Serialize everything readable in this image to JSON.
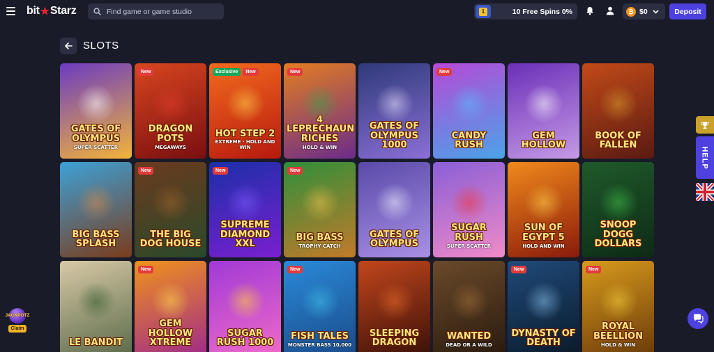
{
  "header": {
    "logo_left": "bit",
    "logo_star": "★",
    "logo_right": "Starz",
    "search_placeholder": "Find game or game studio",
    "level_badge": "1",
    "free_spins": "10 Free Spins 0%",
    "balance": "$0",
    "currency_icon": "bitcoin-icon",
    "deposit_label": "Deposit"
  },
  "page": {
    "title": "SLOTS"
  },
  "games": [
    {
      "name": "Gates of Olympus",
      "sub": "Super Scatter",
      "badges": [],
      "bg": [
        "#6c3bc1",
        "#f2b43a"
      ],
      "art": "#ffffff"
    },
    {
      "name": "Dragon Pots",
      "sub": "Megaways",
      "badges": [
        "New"
      ],
      "bg": [
        "#d7451f",
        "#7a0f10"
      ],
      "art": "#e23b2e"
    },
    {
      "name": "Hot Step 2",
      "sub": "Extreme · Hold and Win",
      "badges": [
        "Exclusive",
        "New"
      ],
      "bg": [
        "#f26a1d",
        "#b7190f"
      ],
      "art": "#ffd34d"
    },
    {
      "name": "4 Leprechaun Riches",
      "sub": "Hold & Win",
      "badges": [
        "New"
      ],
      "bg": [
        "#e37d21",
        "#6b2c8a"
      ],
      "art": "#3aa14a"
    },
    {
      "name": "Gates of Olympus 1000",
      "sub": "",
      "badges": [],
      "bg": [
        "#2f3a7a",
        "#8a6fd6"
      ],
      "art": "#e9e4ff"
    },
    {
      "name": "Candy Rush",
      "sub": "",
      "badges": [
        "New"
      ],
      "bg": [
        "#b64ad6",
        "#4aa3e8"
      ],
      "art": "#5ab8ff"
    },
    {
      "name": "Gem Hollow",
      "sub": "",
      "badges": [],
      "bg": [
        "#6b2fb8",
        "#c59ae6"
      ],
      "art": "#ffffff"
    },
    {
      "name": "Book of Fallen",
      "sub": "",
      "badges": [],
      "bg": [
        "#c24a18",
        "#5a1a12"
      ],
      "art": "#d99a2c"
    },
    {
      "name": "Big Bass Splash",
      "sub": "",
      "badges": [],
      "bg": [
        "#3da1d8",
        "#7a3c1b"
      ],
      "art": "#d88a4a"
    },
    {
      "name": "The Big Dog House",
      "sub": "",
      "badges": [
        "New"
      ],
      "bg": [
        "#6b3a1e",
        "#2a4a2a"
      ],
      "art": "#a0612c"
    },
    {
      "name": "Supreme Diamond XXL",
      "sub": "",
      "badges": [
        "New"
      ],
      "bg": [
        "#1b2fa8",
        "#7a1fd0"
      ],
      "art": "#7c5cff"
    },
    {
      "name": "Big Bass",
      "sub": "Trophy Catch",
      "badges": [
        "New"
      ],
      "bg": [
        "#2f8f3a",
        "#c27a2a"
      ],
      "art": "#f0c04a"
    },
    {
      "name": "Gates of Olympus",
      "sub": "",
      "badges": [],
      "bg": [
        "#5a4aa8",
        "#a890e6"
      ],
      "art": "#f2f2ff"
    },
    {
      "name": "Sugar Rush",
      "sub": "Super Scatter",
      "badges": [],
      "bg": [
        "#8a5fd6",
        "#f08ac8"
      ],
      "art": "#f0323c"
    },
    {
      "name": "Sun of Egypt 5",
      "sub": "Hold and Win",
      "badges": [],
      "bg": [
        "#f08a1c",
        "#8a1a0a"
      ],
      "art": "#ffd24a"
    },
    {
      "name": "Snoop Dogg Dollars",
      "sub": "",
      "badges": [],
      "bg": [
        "#1f5a2a",
        "#0d2a15"
      ],
      "art": "#3fbf4a"
    },
    {
      "name": "Le Bandit",
      "sub": "",
      "badges": [],
      "bg": [
        "#d8c9a6",
        "#5a6a4a"
      ],
      "art": "#2f5a2a"
    },
    {
      "name": "Gem Hollow Xtreme",
      "sub": "",
      "badges": [
        "New"
      ],
      "bg": [
        "#f0921c",
        "#a02a8a"
      ],
      "art": "#ffd84a"
    },
    {
      "name": "Sugar Rush 1000",
      "sub": "",
      "badges": [],
      "bg": [
        "#a03ad6",
        "#f06ac8"
      ],
      "art": "#ffd03a"
    },
    {
      "name": "Fish Tales",
      "sub": "Monster Bass 10,000",
      "badges": [
        "New"
      ],
      "bg": [
        "#2a8ad8",
        "#1a4a8a"
      ],
      "art": "#3fc0e8"
    },
    {
      "name": "Sleeping Dragon",
      "sub": "",
      "badges": [],
      "bg": [
        "#c2461c",
        "#3a1008"
      ],
      "art": "#e86a2a"
    },
    {
      "name": "Wanted",
      "sub": "Dead or a Wild",
      "badges": [],
      "bg": [
        "#6a4a2a",
        "#2a1a0e"
      ],
      "art": "#a0703a"
    },
    {
      "name": "Dynasty of Death",
      "sub": "",
      "badges": [
        "New"
      ],
      "bg": [
        "#1f4a7a",
        "#0a1a2a"
      ],
      "art": "#8ac0e8"
    },
    {
      "name": "Royal Beellion",
      "sub": "Hold & Win",
      "badges": [
        "New"
      ],
      "bg": [
        "#d89a1c",
        "#6a3a0a"
      ],
      "art": "#f2d03a"
    }
  ],
  "side": {
    "help_label": "HELP",
    "language_icon": "uk-flag-icon"
  },
  "jackpot": {
    "label": "JACKPOTZ",
    "claim_label": "Claim"
  }
}
